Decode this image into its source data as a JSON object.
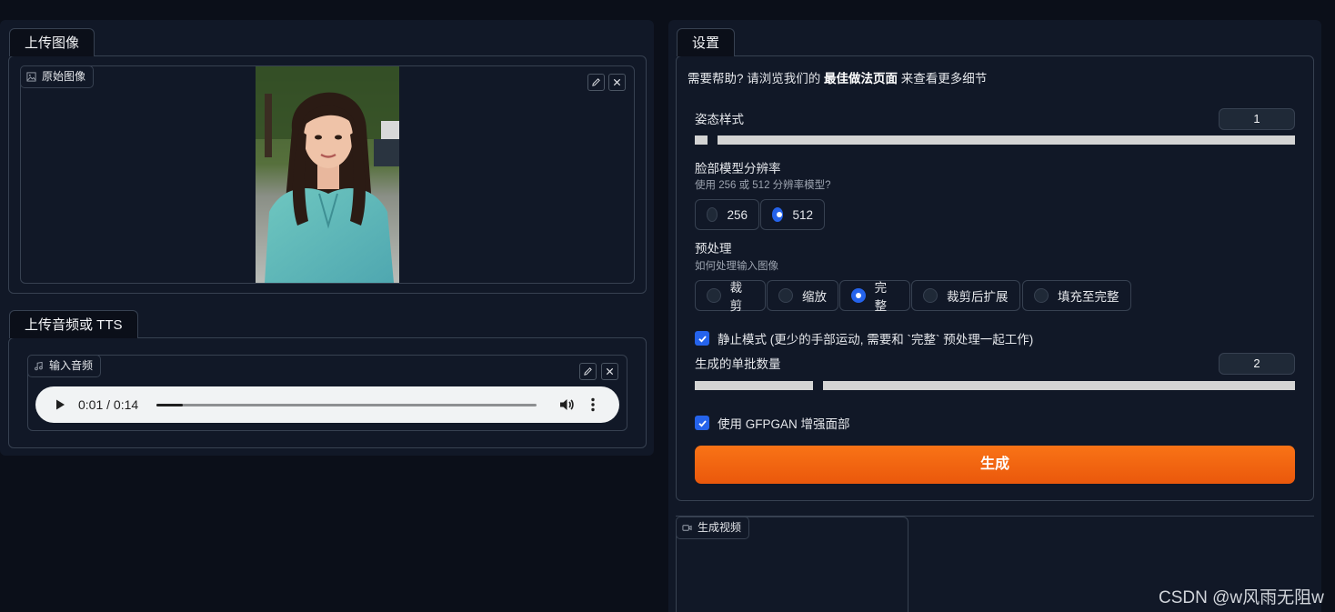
{
  "app": {
    "title": ""
  },
  "left": {
    "upload_tab": "上传图像",
    "image_label": "原始图像",
    "audio_tab": "上传音频或 TTS",
    "audio_label": "输入音频",
    "audio": {
      "time_display": "0:01 / 0:14",
      "progress_pct": 7
    }
  },
  "settings": {
    "tab": "设置",
    "help_prefix": "需要帮助? 请浏览我们的 ",
    "help_link": "最佳做法页面",
    "help_suffix": " 来查看更多细节",
    "pose_style": {
      "label": "姿态样式",
      "value": "1"
    },
    "face_res": {
      "label": "脸部模型分辨率",
      "sub": "使用 256 或 512 分辨率模型?",
      "options": [
        "256",
        "512"
      ],
      "selected": "512"
    },
    "preprocess": {
      "label": "预处理",
      "sub": "如何处理输入图像",
      "options": [
        "裁剪",
        "缩放",
        "完整",
        "裁剪后扩展",
        "填充至完整"
      ],
      "selected": "完整"
    },
    "still_mode": {
      "label": "静止模式 (更少的手部运动, 需要和 `完整` 预处理一起工作)",
      "checked": true
    },
    "batch_size": {
      "label": "生成的单批数量",
      "value": "2"
    },
    "gfpgan": {
      "label": "使用 GFPGAN 增强面部",
      "checked": true
    },
    "generate_button": "生成"
  },
  "output": {
    "video_label": "生成视频"
  },
  "watermark": "CSDN @w风雨无阻w",
  "colors": {
    "accent": "#f97316",
    "radio": "#2563eb",
    "bg": "#0b0f19",
    "panel": "#111827"
  },
  "icons": [
    "image-icon",
    "music-icon",
    "video-icon",
    "edit-icon",
    "close-icon",
    "play-icon",
    "volume-icon",
    "more-vertical-icon",
    "check-icon"
  ]
}
